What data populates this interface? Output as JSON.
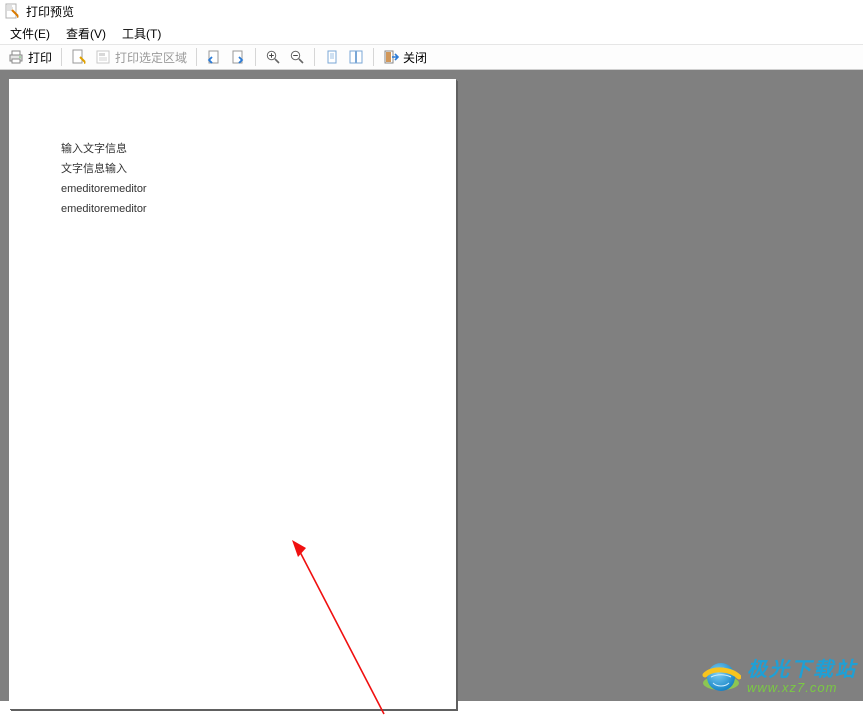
{
  "window": {
    "title": "打印预览"
  },
  "menu": {
    "file": "文件(E)",
    "view": "查看(V)",
    "tools": "工具(T)"
  },
  "toolbar": {
    "print": "打印",
    "selection": "打印选定区域",
    "close": "关闭"
  },
  "document": {
    "lines": {
      "l1": "输入文字信息",
      "l2": "文字信息输入",
      "l3": "emeditoremeditor",
      "l4": "emeditoremeditor"
    }
  },
  "watermark": {
    "line1": "极光下载站",
    "line2": "www.xz7.com"
  }
}
